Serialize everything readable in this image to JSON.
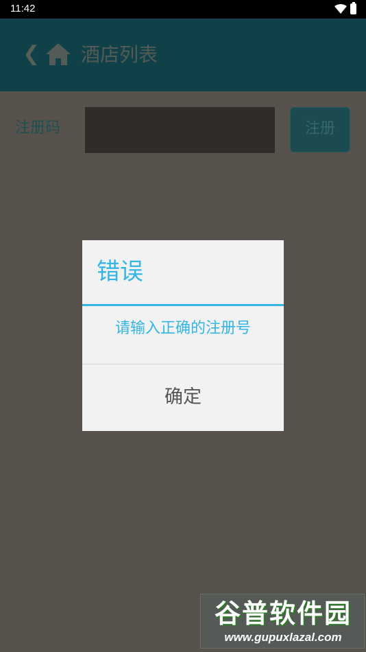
{
  "status_bar": {
    "time": "11:42",
    "icons": [
      "wifi-icon",
      "battery-icon"
    ]
  },
  "app_bar": {
    "back_icon": "chevron-left-icon",
    "home_icon": "home-icon",
    "title": "酒店列表"
  },
  "registration": {
    "label": "注册码",
    "input_value": "",
    "button_label": "注册"
  },
  "dialog": {
    "title": "错误",
    "message": "请输入正确的注册号",
    "ok_label": "确定"
  },
  "watermark": {
    "logo_text": "谷普软件园",
    "url": "www.gupuxlazal.com"
  },
  "colors": {
    "accent": "#33b5e5",
    "scrim_background": "#57524c",
    "app_bar": "#114148",
    "dialog_background": "#f2f2f2"
  }
}
